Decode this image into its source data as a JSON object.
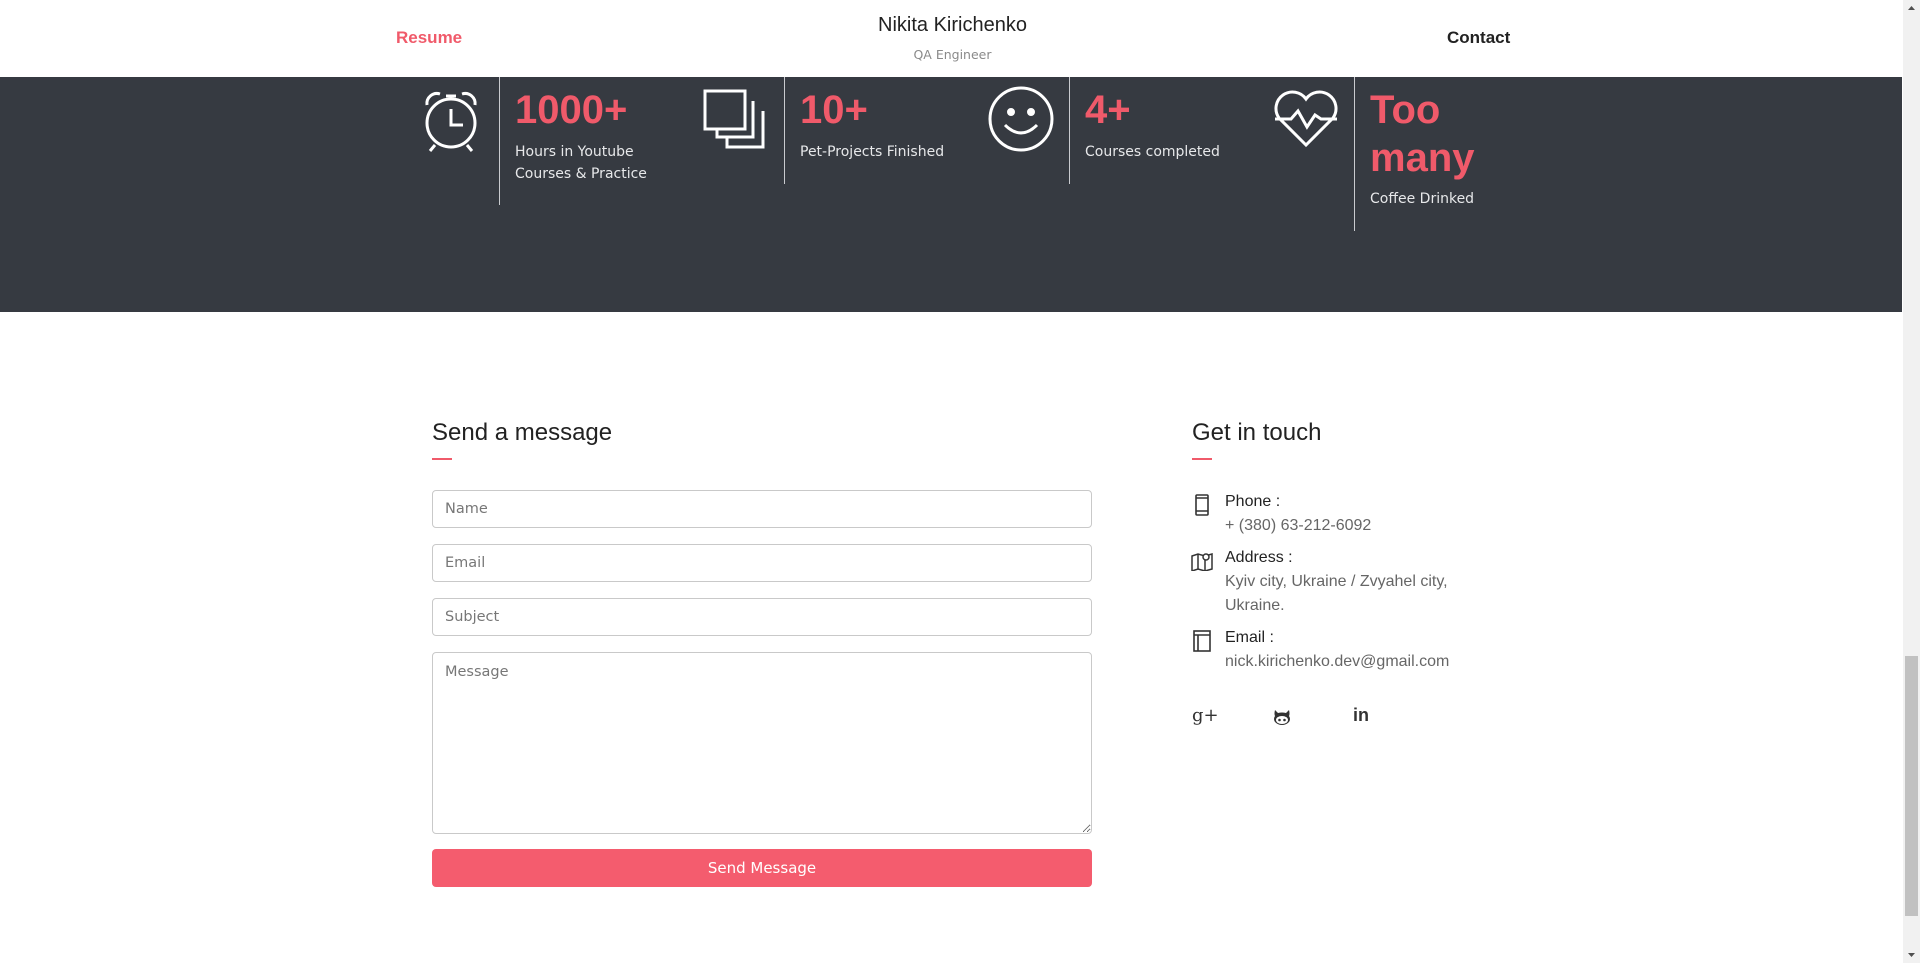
{
  "header": {
    "nav_left": "Resume",
    "nav_right": "Contact",
    "name": "Nikita Kirichenko",
    "role": "QA Engineer"
  },
  "stats": [
    {
      "icon": "alarm-clock-icon",
      "value": "1000+",
      "label_line1": "Hours in Youtube",
      "label_line2": "Courses & Practice"
    },
    {
      "icon": "stacked-squares-icon",
      "value": "10+",
      "label_line1": "Pet-Projects Finished",
      "label_line2": ""
    },
    {
      "icon": "smiley-face-icon",
      "value": "4+",
      "label_line1": "Courses completed",
      "label_line2": ""
    },
    {
      "icon": "heart-pulse-icon",
      "value_line1": "Too",
      "value_line2": "many",
      "label_line1": "Coffee Drinked",
      "label_line2": ""
    }
  ],
  "message_form": {
    "title": "Send a message",
    "name_placeholder": "Name",
    "email_placeholder": "Email",
    "subject_placeholder": "Subject",
    "message_placeholder": "Message",
    "submit_label": "Send Message"
  },
  "contact_info": {
    "title": "Get in touch",
    "phone_label": "Phone :",
    "phone_value": "+ (380) 63-212-6092",
    "address_label": "Address :",
    "address_line1": "Kyiv city, Ukraine / Zvyahel city,",
    "address_line2": "Ukraine.",
    "email_label": "Email :",
    "email_value": "nick.kirichenko.dev@gmail.com"
  },
  "social": [
    {
      "icon": "google-plus-icon",
      "glyph": "g+"
    },
    {
      "icon": "github-icon"
    },
    {
      "icon": "linkedin-icon",
      "glyph": "in"
    }
  ],
  "colors": {
    "accent": "#f05a6a",
    "dark_band": "#363a41",
    "button": "#f45c6e"
  }
}
